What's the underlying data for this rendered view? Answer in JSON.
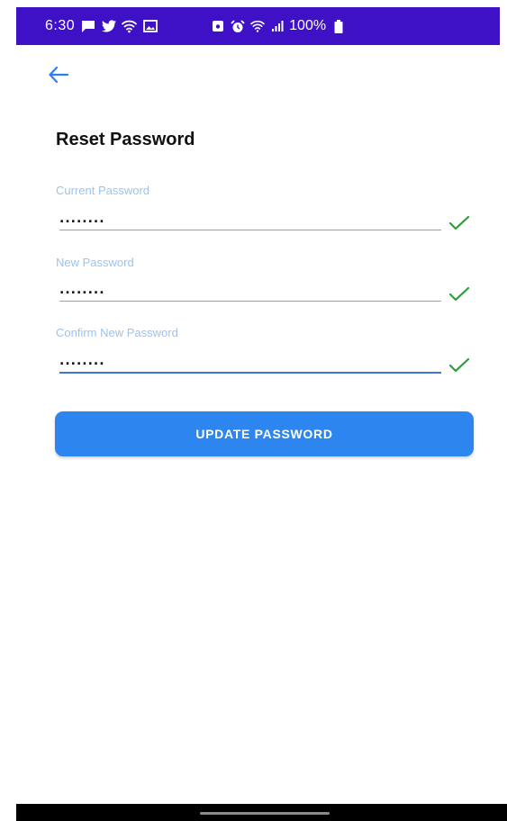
{
  "status_bar": {
    "time": "6:30",
    "battery": "100%",
    "left_icons": [
      "message-icon",
      "twitter-icon",
      "wifi-vpn-icon",
      "image-icon"
    ],
    "right_icons": [
      "lock-icon",
      "alarm-icon",
      "wifi-icon",
      "signal-icon",
      "battery-icon"
    ],
    "background_color": "#3f11c6"
  },
  "header": {
    "back_icon": "arrow-left-icon"
  },
  "form": {
    "title": "Reset Password",
    "fields": [
      {
        "label": "Current Password",
        "value": "........",
        "valid": true
      },
      {
        "label": "New Password",
        "value": "........",
        "valid": true
      },
      {
        "label": "Confirm New Password",
        "value": "........",
        "valid": true,
        "focused": true
      }
    ],
    "submit_label": "UPDATE PASSWORD"
  },
  "colors": {
    "accent": "#2d86f0",
    "label": "#9ec2ee",
    "valid_check": "#2e9e3a"
  }
}
